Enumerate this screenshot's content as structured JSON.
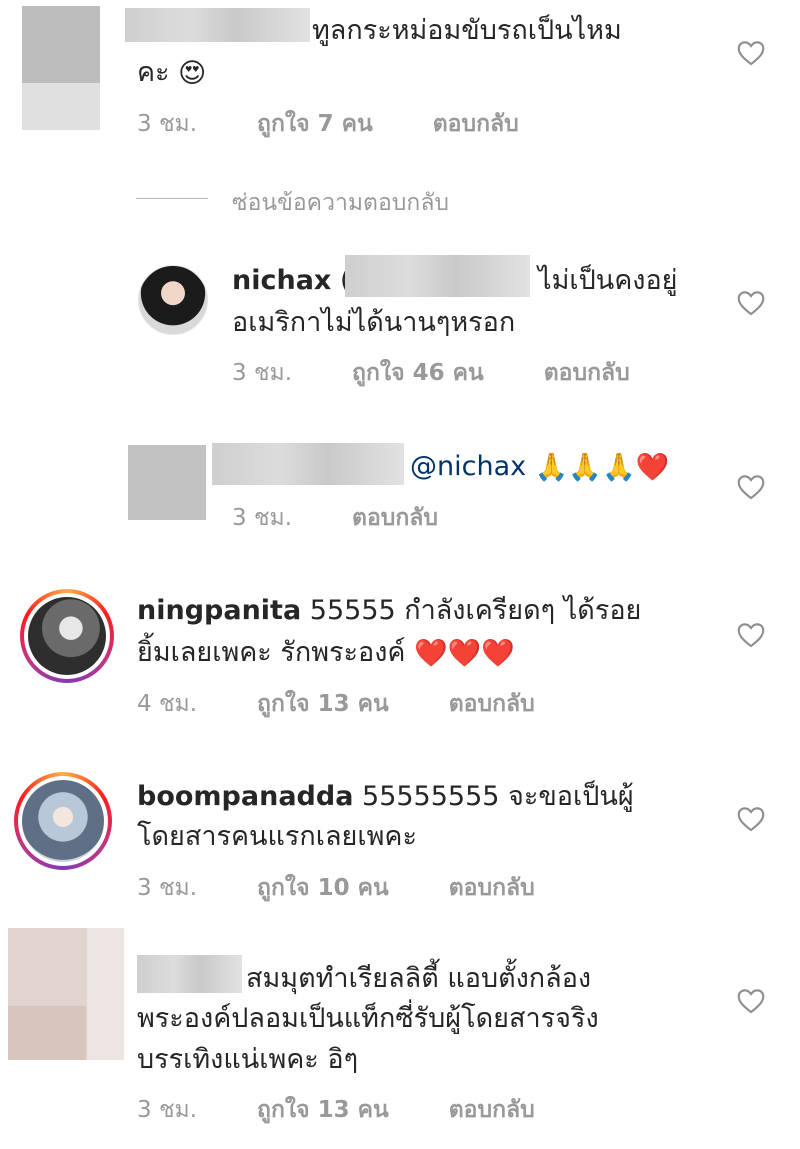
{
  "comments": [
    {
      "id": "c1",
      "text_line1": "ทูลกระหม่อมขับรถเป็นไหม",
      "text_line2": "คะ",
      "emoji": "😍",
      "time": "3 ชม.",
      "likes": "ถูกใจ 7 คน",
      "reply": "ตอบกลับ"
    },
    {
      "id": "hide-replies",
      "label": "ซ่อนข้อความตอบกลับ"
    },
    {
      "id": "c2",
      "username": "nichax",
      "text_line1_prefix": "(",
      "text_line1": "ไม่เป็นคงอยู่",
      "text_line2": "อเมริกาไม่ได้นานๆหรอก",
      "time": "3 ชม.",
      "likes": "ถูกใจ 46 คน",
      "reply": "ตอบกลับ"
    },
    {
      "id": "c3",
      "mention": "@nichax",
      "emoji": "🙏🙏🙏❤️",
      "time": "3 ชม.",
      "reply": "ตอบกลับ"
    },
    {
      "id": "c4",
      "username": "ningpanita",
      "text_line1": "55555 กำลังเครียดๆ ได้รอย",
      "text_line2": "ยิ้มเลยเพคะ รักพระองค์",
      "emoji": "❤️❤️❤️",
      "time": "4 ชม.",
      "likes": "ถูกใจ 13 คน",
      "reply": "ตอบกลับ"
    },
    {
      "id": "c5",
      "username": "boompanadda",
      "text_line1": "55555555 จะขอเป็นผู้",
      "text_line2": "โดยสารคนแรกเลยเพคะ",
      "time": "3 ชม.",
      "likes": "ถูกใจ 10 คน",
      "reply": "ตอบกลับ"
    },
    {
      "id": "c6",
      "text_line1": "สมมุตทำเรียลลิตี้ แอบตั้งกล้อง",
      "text_line2": "พระองค์ปลอมเป็นแท็กซี่รับผู้โดยสารจริง",
      "text_line3": "บรรเทิงแน่เพคะ อิๆ",
      "time": "3 ชม.",
      "likes": "ถูกใจ 13 คน",
      "reply": "ตอบกลับ"
    }
  ],
  "colors": {
    "text": "#262626",
    "meta": "#999999",
    "mention": "#003569",
    "heart_stroke": "#8e8e8e",
    "redacted": "#cfcfcf"
  }
}
